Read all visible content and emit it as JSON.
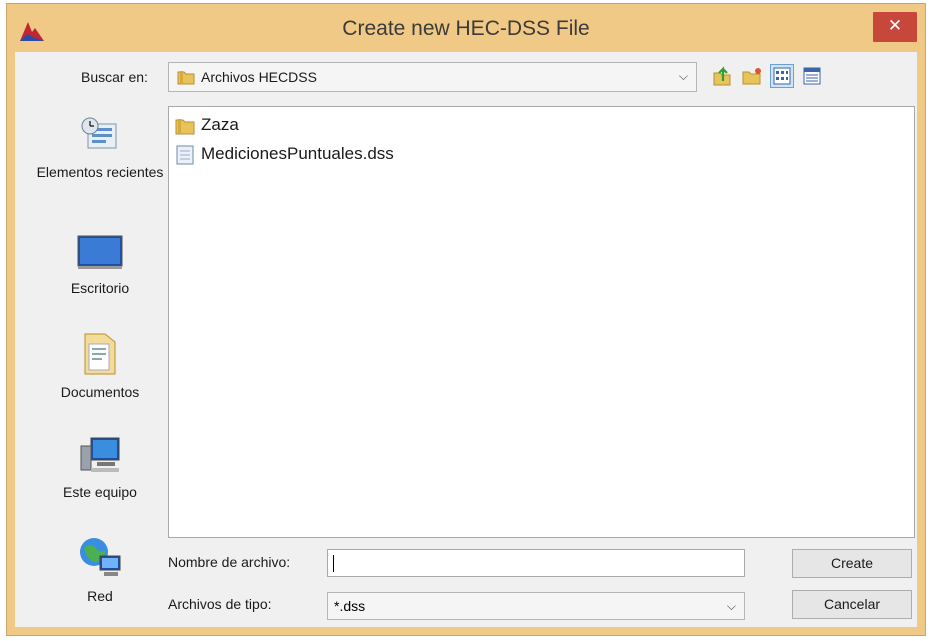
{
  "window": {
    "title": "Create new HEC-DSS File",
    "close_label": "✕"
  },
  "toolbar": {
    "look_in_label": "Buscar en:",
    "look_in_value": "Archivos HECDSS",
    "dropdown_arrow": "⌵"
  },
  "places": [
    {
      "label": "Elementos recientes",
      "icon": "recent-items-icon"
    },
    {
      "label": "Escritorio",
      "icon": "desktop-icon"
    },
    {
      "label": "Documentos",
      "icon": "documents-icon"
    },
    {
      "label": "Este equipo",
      "icon": "computer-icon"
    },
    {
      "label": "Red",
      "icon": "network-icon"
    }
  ],
  "files": [
    {
      "name": "Zaza",
      "icon": "folder-icon"
    },
    {
      "name": "MedicionesPuntuales.dss",
      "icon": "file-icon"
    }
  ],
  "form": {
    "filename_label": "Nombre de archivo:",
    "filename_value": "",
    "filetype_label": "Archivos de tipo:",
    "filetype_value": "*.dss",
    "filetype_arrow": "⌵"
  },
  "buttons": {
    "create": "Create",
    "cancel": "Cancelar"
  }
}
